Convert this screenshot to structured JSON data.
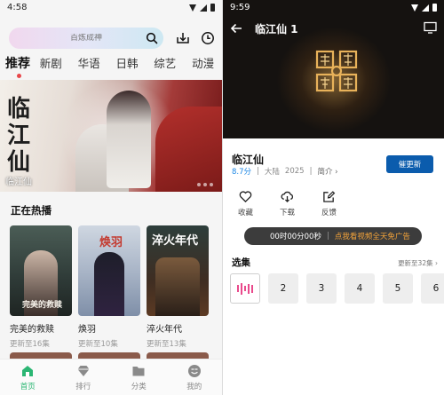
{
  "left": {
    "status_time": "4:58",
    "search": {
      "placeholder": "百炼成神"
    },
    "tabs": [
      {
        "label": "推荐",
        "active": true
      },
      {
        "label": "新剧"
      },
      {
        "label": "华语"
      },
      {
        "label": "日韩"
      },
      {
        "label": "综艺"
      },
      {
        "label": "动漫"
      }
    ],
    "banner": {
      "calligraphy": "临江仙",
      "title": "临江仙"
    },
    "section_title": "正在热播",
    "cards": [
      {
        "name": "完美的救赎",
        "status": "更新至16集",
        "poster_text": "完美的救赎"
      },
      {
        "name": "焕羽",
        "status": "更新至10集",
        "poster_text": "焕羽"
      },
      {
        "name": "淬火年代",
        "status": "更新至13集",
        "poster_text": "淬火年代"
      }
    ],
    "bottom_nav": [
      {
        "label": "首页",
        "icon": "home-icon",
        "active": true
      },
      {
        "label": "排行",
        "icon": "diamond-icon"
      },
      {
        "label": "分类",
        "icon": "folder-icon"
      },
      {
        "label": "我的",
        "icon": "profile-icon"
      }
    ]
  },
  "right": {
    "status_time": "9:59",
    "player": {
      "title": "临江仙 1"
    },
    "show": {
      "title": "临江仙",
      "score": "8.7分",
      "region": "大陆",
      "year": "2025",
      "intro_label": "简介 ›",
      "update_button": "催更新"
    },
    "actions": [
      {
        "label": "收藏",
        "icon": "heart-icon"
      },
      {
        "label": "下载",
        "icon": "download-icon"
      },
      {
        "label": "反馈",
        "icon": "edit-icon"
      }
    ],
    "ad_bar": {
      "timer": "00时00分00秒",
      "separator": "|",
      "link": "点我看视频全天免广告"
    },
    "episodes_title": "选集",
    "episodes_more": "更新至32集 ›",
    "episodes": [
      "1",
      "2",
      "3",
      "4",
      "5",
      "6"
    ]
  },
  "colors": {
    "accent_green": "#2bb673",
    "tab_indicator": "#e8474b",
    "update_button": "#0b5cad",
    "ad_link": "#f2a23a",
    "score": "#1e88e5",
    "playing": "#e94a8c"
  }
}
